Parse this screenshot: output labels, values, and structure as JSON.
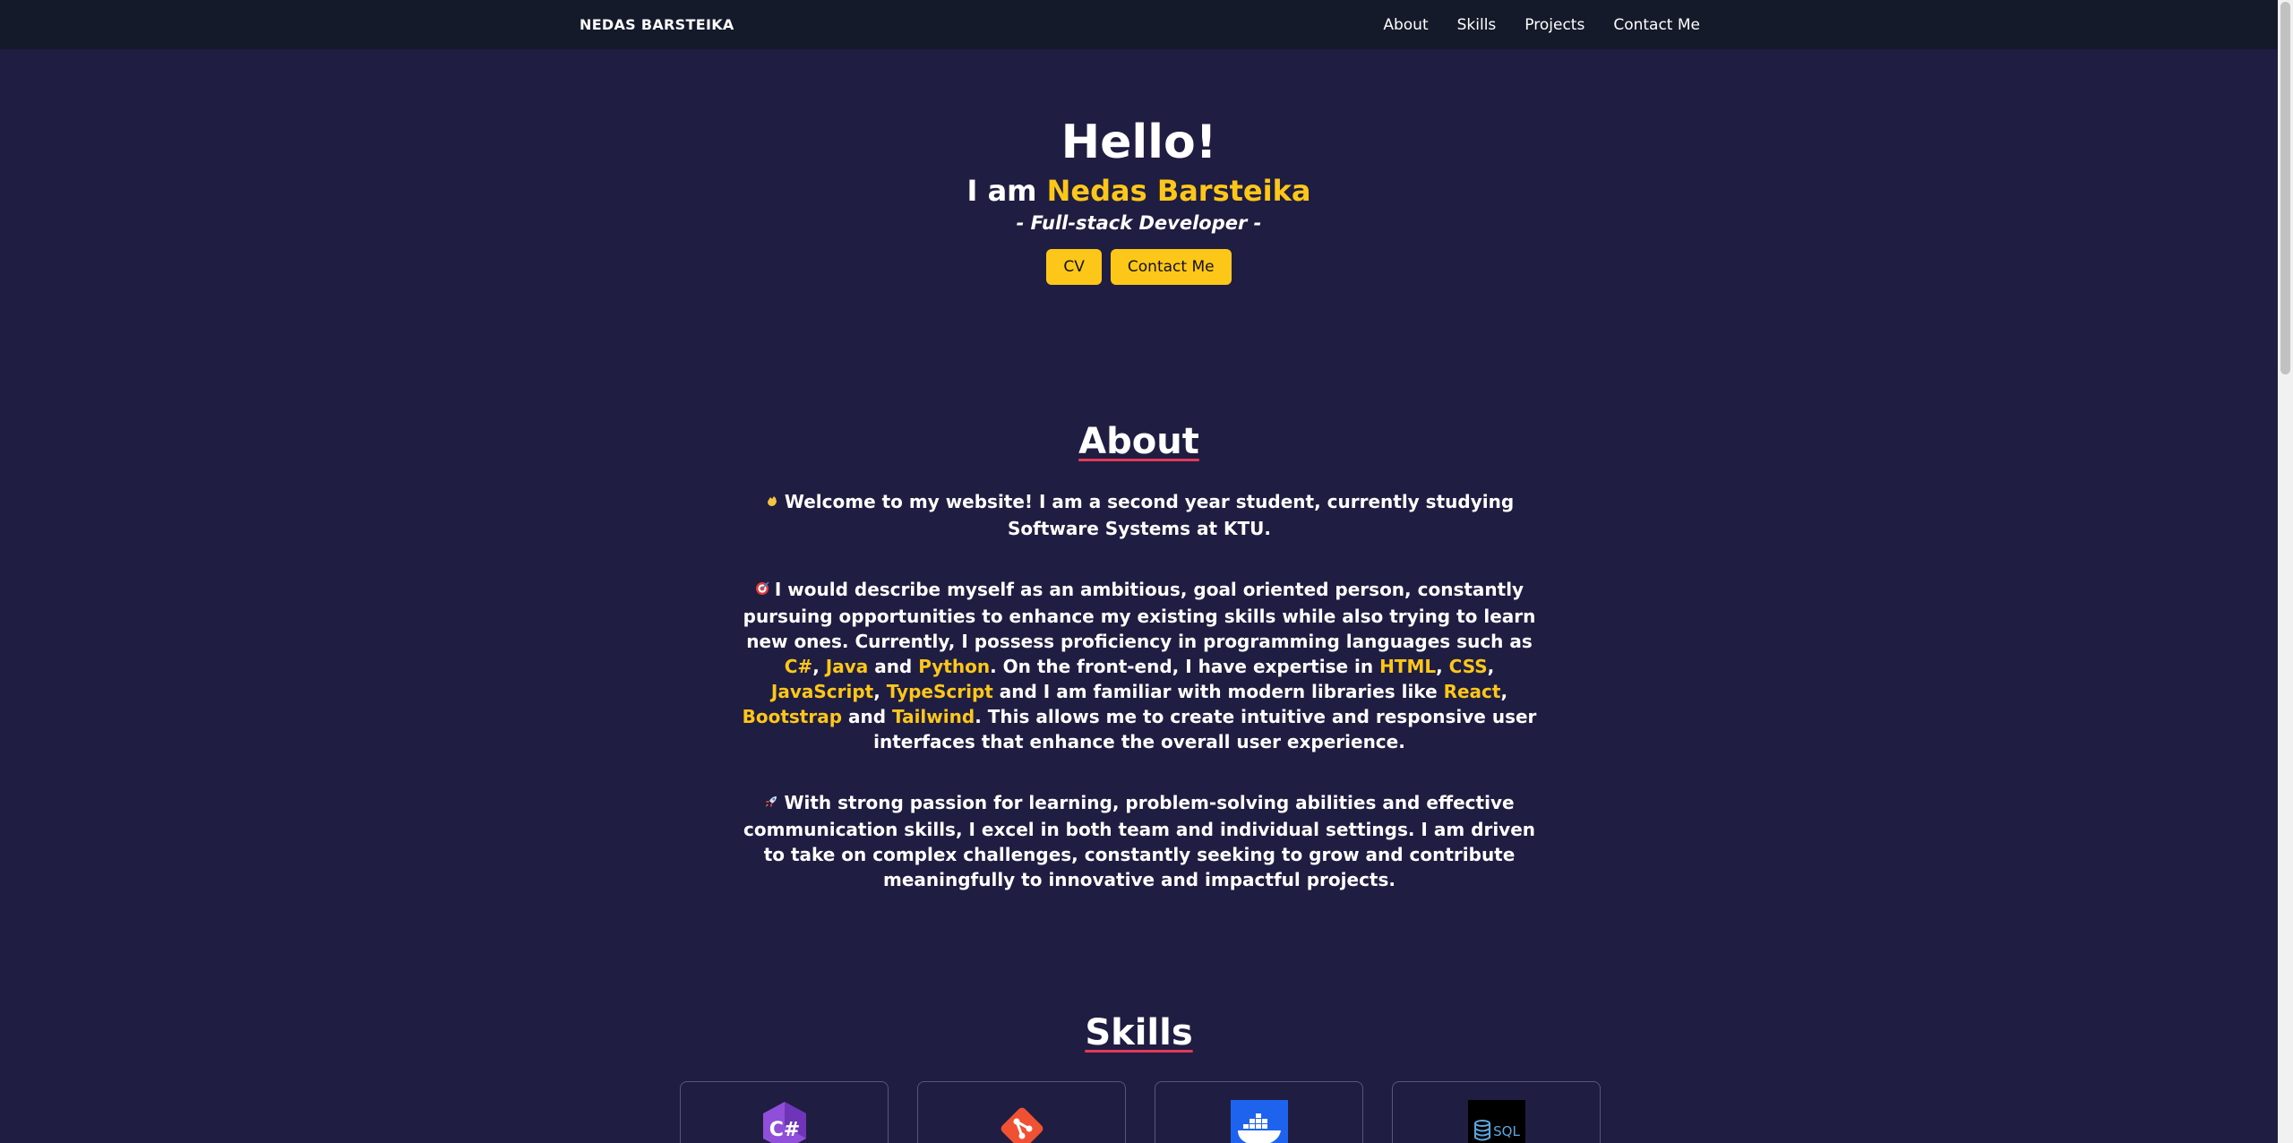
{
  "navbar": {
    "brand": "NEDAS BARSTEIKA",
    "links": [
      "About",
      "Skills",
      "Projects",
      "Contact Me"
    ]
  },
  "hero": {
    "greeting": "Hello!",
    "intro_prefix": "I am ",
    "name": "Nedas Barsteika",
    "role": "- Full-stack Developer -",
    "cv_button": "CV",
    "contact_button": "Contact Me"
  },
  "about": {
    "title": "About",
    "p1": "Welcome to my website! I am a second year student, currently studying Software Systems at KTU.",
    "p2": {
      "t1": "I would describe myself as an ambitious, goal oriented person, constantly pursuing opportunities to enhance my existing skills while also trying to learn new ones. Currently, I possess proficiency in programming languages such as ",
      "csharp": "C#",
      "sep1": ", ",
      "java": "Java",
      "and1": " and ",
      "python": "Python",
      "t2": ". On the front-end, I have expertise in ",
      "html": "HTML",
      "sep2": ", ",
      "css": "CSS",
      "sep3": ", ",
      "javascript": "JavaScript",
      "sep4": ", ",
      "typescript": "TypeScript",
      "t3": " and I am familiar with modern libraries like ",
      "react": "React",
      "sep5": ", ",
      "bootstrap": "Bootstrap",
      "and2": " and ",
      "tailwind": "Tailwind",
      "t4": ". This allows me to create intuitive and responsive user interfaces that enhance the overall user experience."
    },
    "p3": "With strong passion for learning, problem-solving abilities and effective communication skills, I excel in both team and individual settings. I am driven to take on complex challenges, constantly seeking to grow and contribute meaningfully to innovative and impactful projects."
  },
  "skills": {
    "title": "Skills",
    "cards": [
      {
        "icon": "csharp-icon",
        "icon_text": "C#"
      },
      {
        "icon": "git-icon"
      },
      {
        "icon": "docker-icon"
      },
      {
        "icon": "sql-icon",
        "icon_text": "SQL"
      }
    ]
  },
  "colors": {
    "background": "#1f1d42",
    "navbar": "#151a2a",
    "accent": "#fdc719",
    "underline": "#e23a57"
  }
}
